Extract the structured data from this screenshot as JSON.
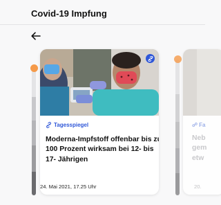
{
  "header": {
    "title": "Covid-19 Impfung"
  },
  "icons": {
    "back": "arrow-left-icon",
    "badge": "link-icon",
    "source": "link-icon"
  },
  "colors": {
    "accent": "#2f57d8",
    "progress_active": "#f59a4a"
  },
  "cards": [
    {
      "source": "Tagesspiegel",
      "headline": "Moderna-Impfstoff offenbar bis zu 100 Prozent wirksam bei 12- bis 17- Jährigen",
      "date": "24. Mai 2021, 17.25 Uhr"
    },
    {
      "source": "Fa",
      "headline": "Neb\ngem\netw",
      "date": "20."
    }
  ]
}
